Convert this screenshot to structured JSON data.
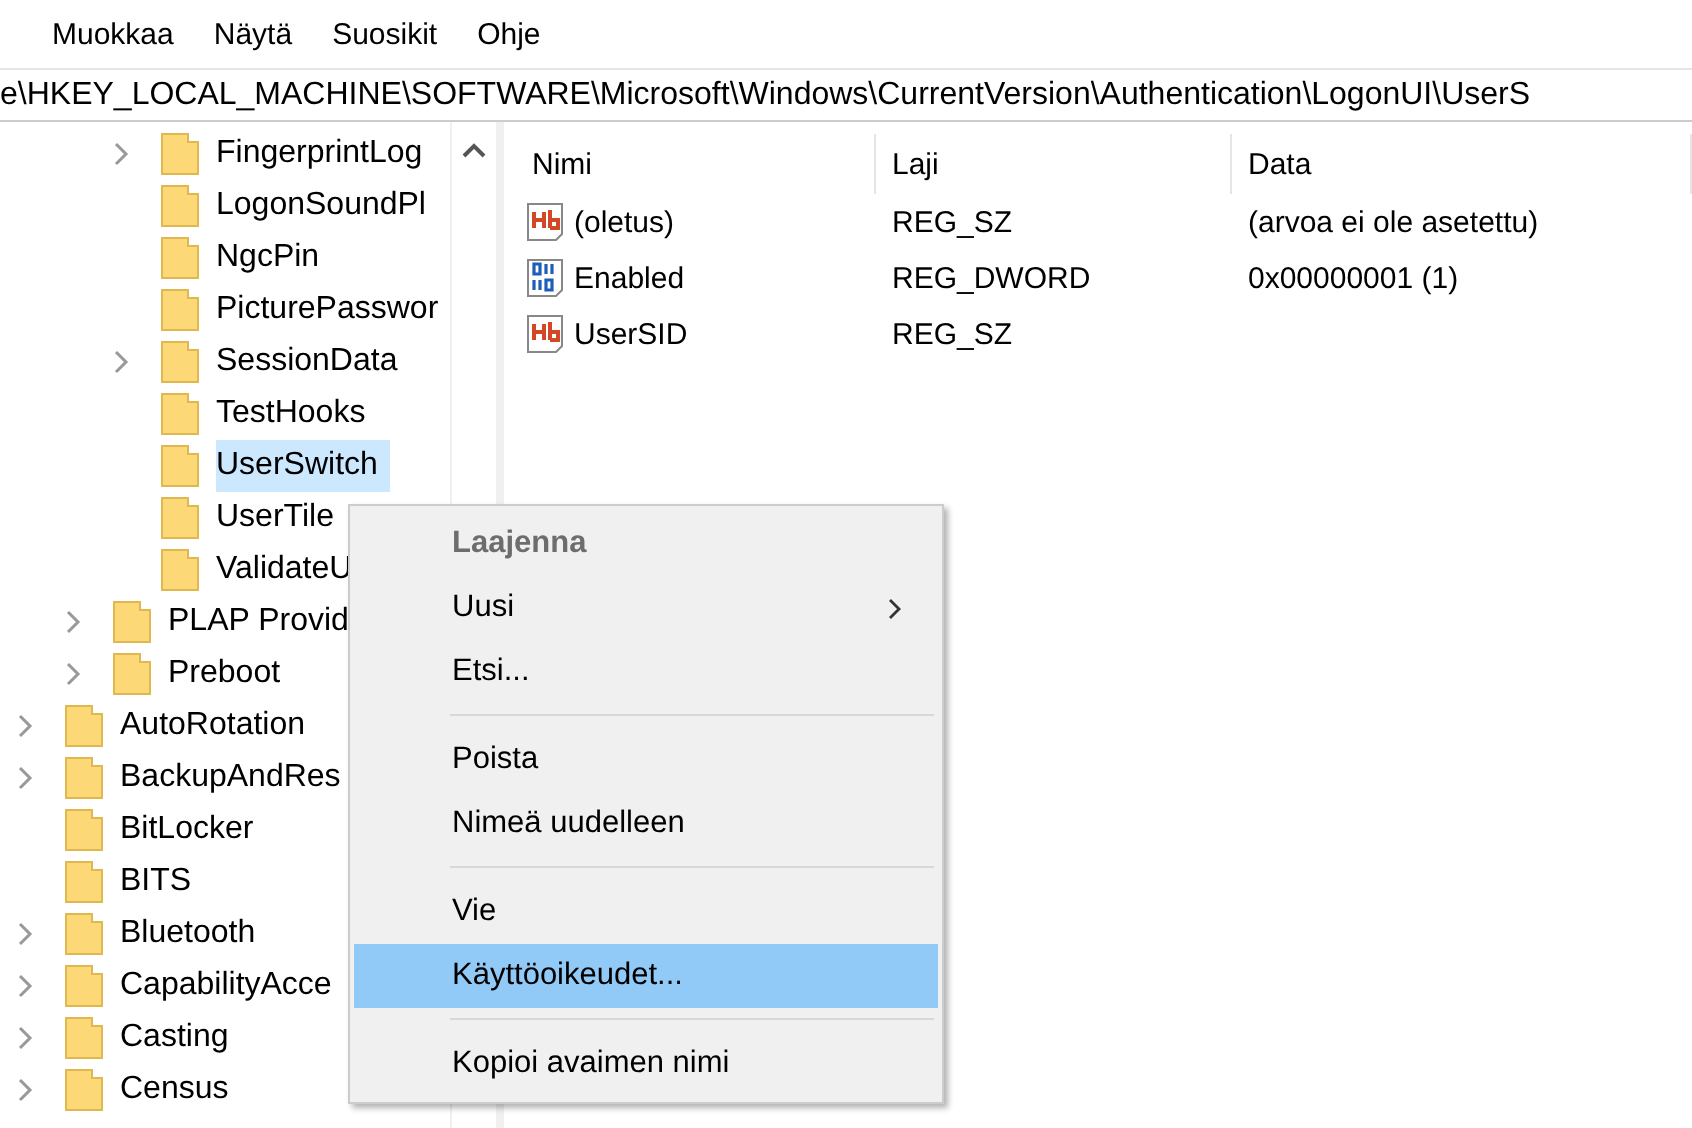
{
  "menu_bar": [
    "Muokkaa",
    "Näytä",
    "Suosikit",
    "Ohje"
  ],
  "address_bar": {
    "value": "e\\HKEY_LOCAL_MACHINE\\SOFTWARE\\Microsoft\\Windows\\CurrentVersion\\Authentication\\LogonUI\\UserS"
  },
  "tree": {
    "items": [
      {
        "children": [
          {
            "children": [
              {
                "label": "FingerprintLog",
                "expandable": true,
                "selected": false
              },
              {
                "label": "LogonSoundPl",
                "expandable": false,
                "selected": false
              },
              {
                "label": "NgcPin",
                "expandable": false,
                "selected": false
              },
              {
                "label": "PicturePasswor",
                "expandable": false,
                "selected": false
              },
              {
                "label": "SessionData",
                "expandable": true,
                "selected": false
              },
              {
                "label": "TestHooks",
                "expandable": false,
                "selected": false
              },
              {
                "label": "UserSwitch",
                "expandable": false,
                "selected": true
              },
              {
                "label": "UserTile",
                "expandable": false,
                "selected": false
              },
              {
                "label": "ValidateU",
                "expandable": false,
                "selected": false
              }
            ]
          },
          {
            "label": "PLAP Provid",
            "expandable": true,
            "selected": false
          },
          {
            "label": "Preboot",
            "expandable": true,
            "selected": false
          }
        ]
      },
      {
        "label": "AutoRotation",
        "expandable": true,
        "selected": false
      },
      {
        "label": "BackupAndRes",
        "expandable": true,
        "selected": false
      },
      {
        "label": "BitLocker",
        "expandable": false,
        "selected": false
      },
      {
        "label": "BITS",
        "expandable": false,
        "selected": false
      },
      {
        "label": "Bluetooth",
        "expandable": true,
        "selected": false
      },
      {
        "label": "CapabilityAcce",
        "expandable": true,
        "selected": false
      },
      {
        "label": "Casting",
        "expandable": true,
        "selected": false
      },
      {
        "label": "Census",
        "expandable": true,
        "selected": false
      }
    ]
  },
  "values_table": {
    "columns": [
      "Nimi",
      "Laji",
      "Data"
    ],
    "rows": [
      {
        "kind": "string",
        "name": "(oletus)",
        "type": "REG_SZ",
        "data": "(arvoa ei ole asetettu)"
      },
      {
        "kind": "binary",
        "name": "Enabled",
        "type": "REG_DWORD",
        "data": "0x00000001 (1)"
      },
      {
        "kind": "string",
        "name": "UserSID",
        "type": "REG_SZ"
      }
    ]
  },
  "context_menu": [
    {
      "kind": "item",
      "label": "Laajenna",
      "disabled": true,
      "selected": false,
      "submenu": false
    },
    {
      "kind": "item",
      "label": "Uusi",
      "disabled": false,
      "selected": false,
      "submenu": true
    },
    {
      "kind": "item",
      "label": "Etsi...",
      "disabled": false,
      "selected": false,
      "submenu": false
    },
    {
      "kind": "separator"
    },
    {
      "kind": "item",
      "label": "Poista",
      "disabled": false,
      "selected": false,
      "submenu": false
    },
    {
      "kind": "item",
      "label": "Nimeä uudelleen",
      "disabled": false,
      "selected": false,
      "submenu": false
    },
    {
      "kind": "separator"
    },
    {
      "kind": "item",
      "label": "Vie",
      "disabled": false,
      "selected": false,
      "submenu": false
    },
    {
      "kind": "item",
      "label": "Käyttöoikeudet...",
      "disabled": false,
      "selected": true,
      "submenu": false
    },
    {
      "kind": "separator"
    },
    {
      "kind": "item",
      "label": "Kopioi avaimen nimi",
      "disabled": false,
      "selected": false,
      "submenu": false
    }
  ]
}
